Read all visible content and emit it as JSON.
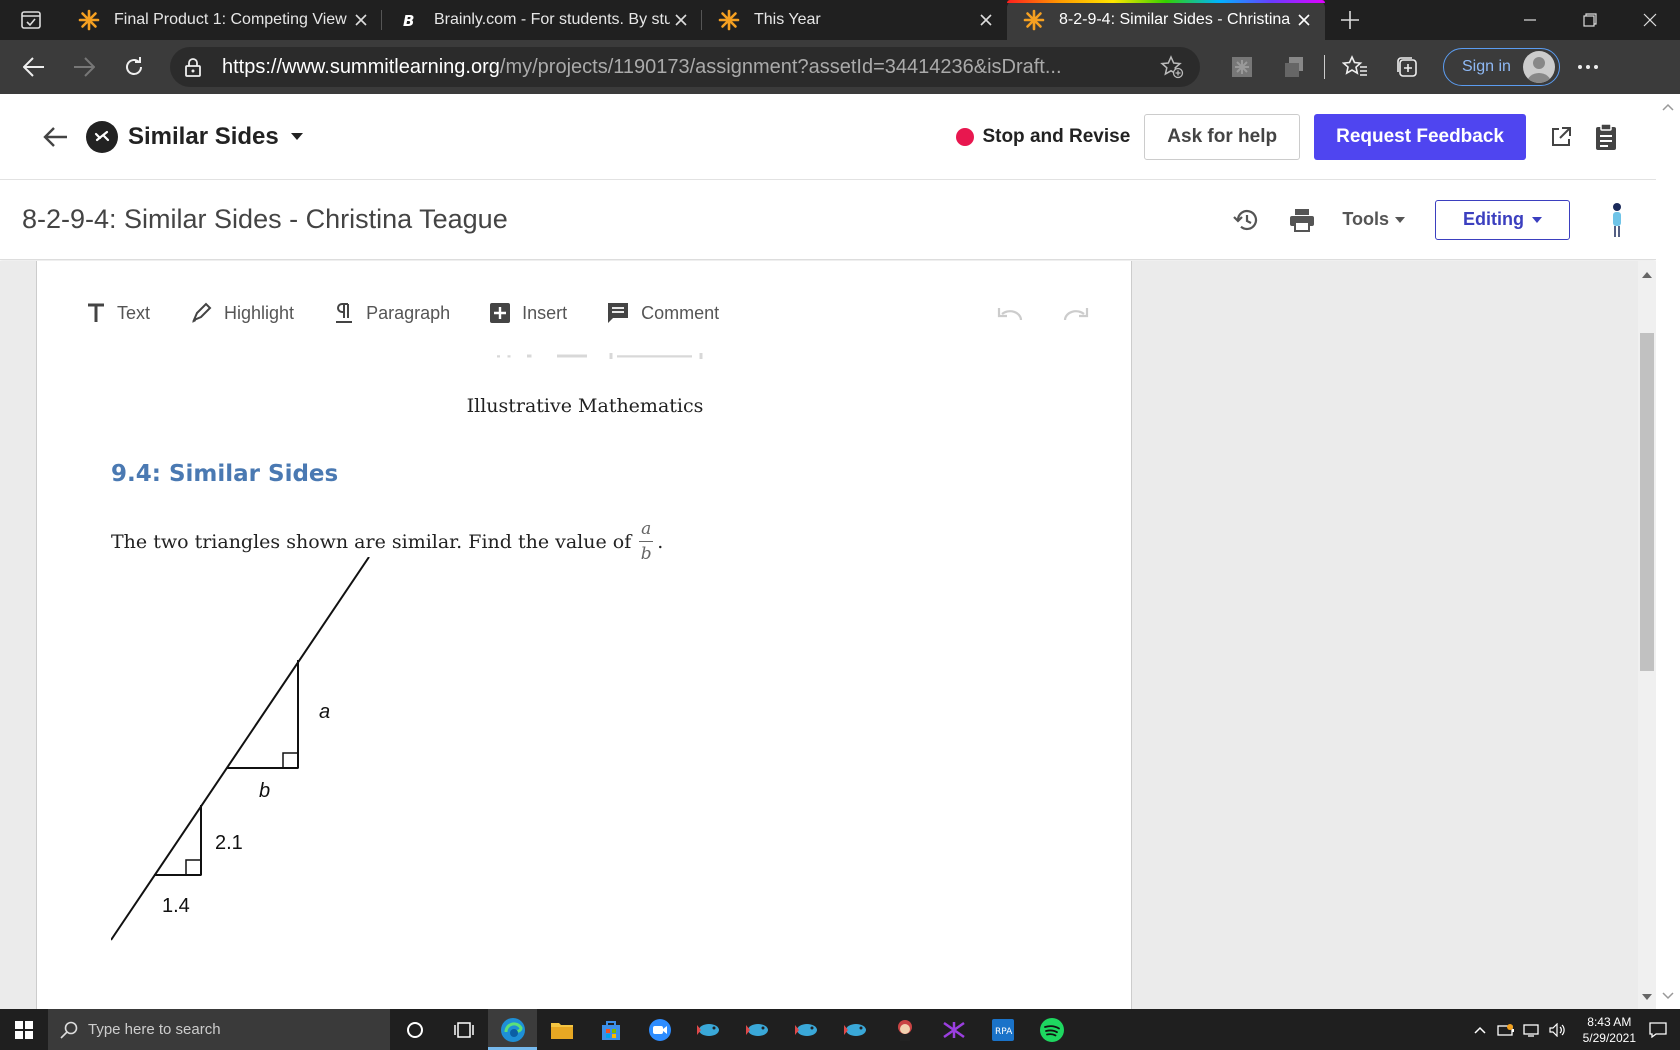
{
  "browser": {
    "tabs": [
      {
        "title": "Final Product 1: Competing View",
        "favicon": "summit-asterisk-icon",
        "active": false
      },
      {
        "title": "Brainly.com - For students. By stu",
        "favicon": "brainly-b-icon",
        "active": false
      },
      {
        "title": "This Year",
        "favicon": "summit-asterisk-icon",
        "active": false
      },
      {
        "title": "8-2-9-4: Similar Sides - Christina",
        "favicon": "summit-asterisk-icon",
        "active": true
      }
    ],
    "url_host": "https://www.summitlearning.org",
    "url_path": "/my/projects/1190173/assignment?assetId=34414236&isDraft...",
    "sign_in_label": "Sign in"
  },
  "app_header": {
    "project_title": "Similar Sides",
    "status_label": "Stop and Revise",
    "status_color": "#e8174f",
    "ask_help_label": "Ask for help",
    "request_feedback_label": "Request Feedback",
    "accent_color": "#4f45f0"
  },
  "doc_header": {
    "title": "8-2-9-4: Similar Sides - Christina Teague",
    "tools_label": "Tools",
    "editing_label": "Editing"
  },
  "edit_toolbar": {
    "items": [
      {
        "label": "Text",
        "icon": "text-icon"
      },
      {
        "label": "Highlight",
        "icon": "highlight-icon"
      },
      {
        "label": "Paragraph",
        "icon": "paragraph-icon"
      },
      {
        "label": "Insert",
        "icon": "insert-icon"
      },
      {
        "label": "Comment",
        "icon": "comment-icon"
      }
    ]
  },
  "document": {
    "attribution": "Illustrative Mathematics",
    "section_title": "9.4: Similar Sides",
    "problem_text": "The two triangles shown are similar. Find the value of",
    "fraction_numerator": "a",
    "fraction_denominator": "b",
    "problem_end": ".",
    "figure": {
      "large_vertical_label": "a",
      "large_horizontal_label": "b",
      "small_vertical_label": "2.1",
      "small_horizontal_label": "1.4"
    }
  },
  "taskbar": {
    "search_placeholder": "Type here to search",
    "time": "8:43 AM",
    "date": "5/29/2021"
  }
}
